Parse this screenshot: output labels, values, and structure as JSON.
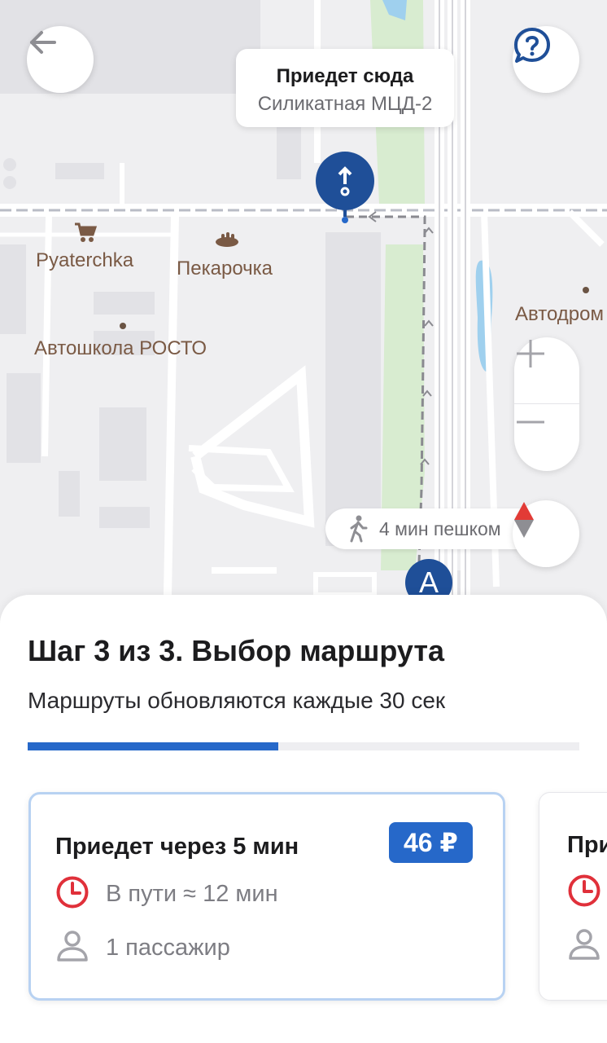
{
  "header": {
    "back_icon": "arrow-left-icon",
    "help_icon": "question-bubble-icon"
  },
  "map": {
    "destination_callout": {
      "title": "Приедет сюда",
      "subtitle": "Силикатная МЦД-2"
    },
    "pois": [
      {
        "label": "Pyaterchka",
        "icon": "cart-icon"
      },
      {
        "label": "Пекарочка",
        "icon": "bakery-icon"
      },
      {
        "label": "Автошкола РОСТО",
        "icon": "dot-icon"
      },
      {
        "label": "Автодром",
        "icon": "dot-icon"
      }
    ],
    "walk_pill": {
      "text": "4 мин пешком",
      "icon": "walking-person-icon"
    },
    "start_marker": "A",
    "zoom": {
      "in_icon": "plus-icon",
      "out_icon": "minus-icon"
    },
    "compass_icon": "compass-icon"
  },
  "sheet": {
    "title": "Шаг 3 из 3. Выбор маршрута",
    "subtitle": "Маршруты обновляются каждые 30 сек",
    "progress": 0.455,
    "routes": [
      {
        "title": "Приедет через 5 мин",
        "price": "46 ₽",
        "travel": "В пути ≈ 12 мин",
        "passengers": "1 пассажир",
        "selected": true
      },
      {
        "title": "Приедет через",
        "selected": false
      }
    ]
  },
  "colors": {
    "accent": "#2668c9",
    "marker": "#1f4f98",
    "clock": "#e0303a",
    "park": "#d8ecd0",
    "map_bg": "#efeff1"
  }
}
